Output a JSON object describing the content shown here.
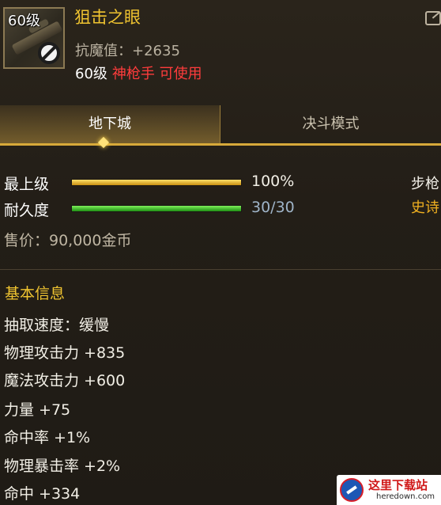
{
  "item": {
    "level_tag": "60级",
    "name": "狙击之眼",
    "stat_line": "抗魔值：+2635",
    "req_level": "60级",
    "req_class": "神枪手 可使用"
  },
  "tabs": [
    {
      "label": "地下城",
      "active": true
    },
    {
      "label": "决斗模式",
      "active": false
    }
  ],
  "attributes": [
    {
      "label": "最上级",
      "value": "100%",
      "fill_fraction": 1.0,
      "color": "#e0a81e"
    },
    {
      "label": "耐久度",
      "value": "30/30",
      "fill_fraction": 1.0,
      "color": "#2fbf1f"
    }
  ],
  "price": "售价：90,000金币",
  "side": {
    "type": "步枪",
    "rarity": "史诗"
  },
  "basic_info": {
    "title": "基本信息",
    "lines": [
      "抽取速度：缓慢",
      "物理攻击力 +835",
      "魔法攻击力 +600",
      "力量 +75",
      "命中率 +1%",
      "物理暴击率 +2%",
      "命中 +334"
    ]
  },
  "watermark": {
    "cn": "这里下载站",
    "en": "heredown.com"
  },
  "colors": {
    "gold": "#f0c430",
    "red": "#ff3c3c",
    "rarity": "#f0b020"
  }
}
